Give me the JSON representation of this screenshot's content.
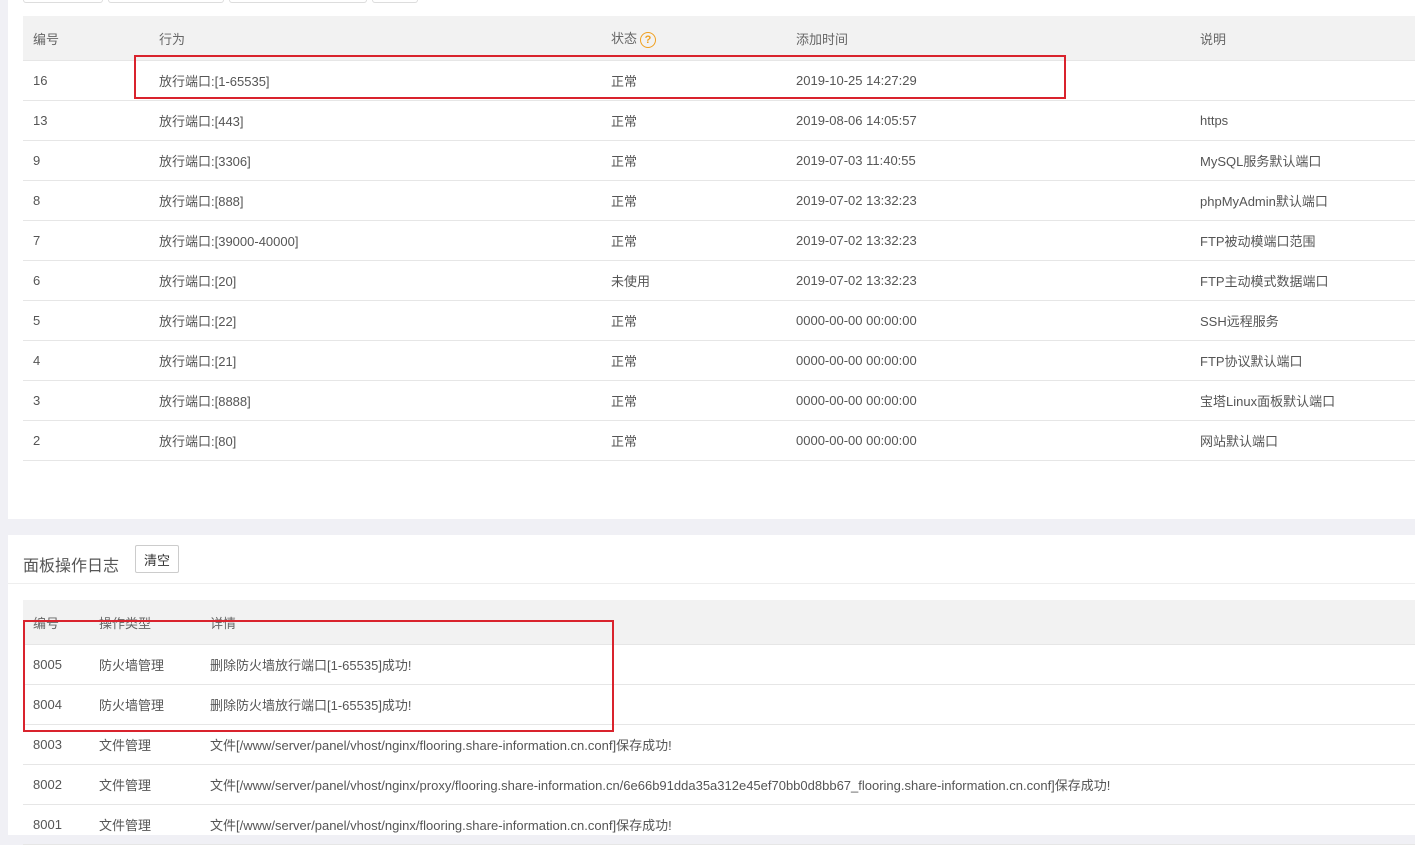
{
  "firewall": {
    "columns": {
      "id": "编号",
      "action": "行为",
      "status": "状态",
      "added": "添加时间",
      "note": "说明"
    },
    "rows": [
      {
        "id": "16",
        "action": "放行端口:[1-65535]",
        "status": "正常",
        "added": "2019-10-25 14:27:29",
        "note": ""
      },
      {
        "id": "13",
        "action": "放行端口:[443]",
        "status": "正常",
        "added": "2019-08-06 14:05:57",
        "note": "https"
      },
      {
        "id": "9",
        "action": "放行端口:[3306]",
        "status": "正常",
        "added": "2019-07-03 11:40:55",
        "note": "MySQL服务默认端口"
      },
      {
        "id": "8",
        "action": "放行端口:[888]",
        "status": "正常",
        "added": "2019-07-02 13:32:23",
        "note": "phpMyAdmin默认端口"
      },
      {
        "id": "7",
        "action": "放行端口:[39000-40000]",
        "status": "正常",
        "added": "2019-07-02 13:32:23",
        "note": "FTP被动模端口范围"
      },
      {
        "id": "6",
        "action": "放行端口:[20]",
        "status": "未使用",
        "added": "2019-07-02 13:32:23",
        "note": "FTP主动模式数据端口"
      },
      {
        "id": "5",
        "action": "放行端口:[22]",
        "status": "正常",
        "added": "0000-00-00 00:00:00",
        "note": "SSH远程服务"
      },
      {
        "id": "4",
        "action": "放行端口:[21]",
        "status": "正常",
        "added": "0000-00-00 00:00:00",
        "note": "FTP协议默认端口"
      },
      {
        "id": "3",
        "action": "放行端口:[8888]",
        "status": "正常",
        "added": "0000-00-00 00:00:00",
        "note": "宝塔Linux面板默认端口"
      },
      {
        "id": "2",
        "action": "放行端口:[80]",
        "status": "正常",
        "added": "0000-00-00 00:00:00",
        "note": "网站默认端口"
      }
    ]
  },
  "log": {
    "title": "面板操作日志",
    "clear_label": "清空",
    "columns": {
      "id": "编号",
      "type": "操作类型",
      "detail": "详情"
    },
    "rows": [
      {
        "id": "8005",
        "type": "防火墙管理",
        "detail": "删除防火墙放行端口[1-65535]成功!"
      },
      {
        "id": "8004",
        "type": "防火墙管理",
        "detail": "删除防火墙放行端口[1-65535]成功!"
      },
      {
        "id": "8003",
        "type": "文件管理",
        "detail": "文件[/www/server/panel/vhost/nginx/flooring.share-information.cn.conf]保存成功!"
      },
      {
        "id": "8002",
        "type": "文件管理",
        "detail": "文件[/www/server/panel/vhost/nginx/proxy/flooring.share-information.cn/6e66b91dda35a312e45ef70bb0d8bb67_flooring.share-information.cn.conf]保存成功!"
      },
      {
        "id": "8001",
        "type": "文件管理",
        "detail": "文件[/www/server/panel/vhost/nginx/flooring.share-information.cn.conf]保存成功!"
      }
    ]
  },
  "colors": {
    "highlight": "#d9232d",
    "help_icon": "#f0a020"
  },
  "icons": {
    "status_help": "question-circle-icon"
  }
}
